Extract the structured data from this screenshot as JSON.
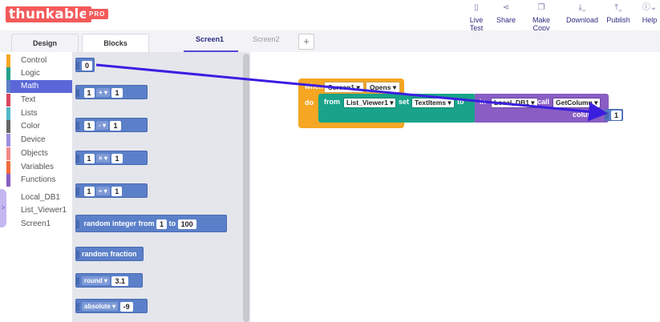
{
  "header": {
    "logo": "thunkable",
    "badge": "PRO",
    "tools": [
      {
        "label": "Live Test",
        "icon": "phone-icon",
        "glyph": "▯"
      },
      {
        "label": "Share",
        "icon": "share-icon",
        "glyph": "⋖"
      },
      {
        "label": "Make Copy",
        "icon": "copy-icon",
        "glyph": "❐"
      },
      {
        "label": "Download",
        "icon": "download-icon",
        "glyph": "⤓⌄"
      },
      {
        "label": "Publish",
        "icon": "upload-icon",
        "glyph": "⤒⌄"
      },
      {
        "label": "Help",
        "icon": "help-icon",
        "glyph": "ⓘ⌄"
      }
    ]
  },
  "tabs": {
    "design": "Design",
    "blocks": "Blocks",
    "screens": [
      "Screen1",
      "Screen2"
    ],
    "add": "+"
  },
  "sidebar": {
    "categories": [
      {
        "label": "Control",
        "color": "#f5a623"
      },
      {
        "label": "Logic",
        "color": "#22a08a"
      },
      {
        "label": "Math",
        "color": "#5b80c9"
      },
      {
        "label": "Text",
        "color": "#d9475c"
      },
      {
        "label": "Lists",
        "color": "#4fb8c9"
      },
      {
        "label": "Color",
        "color": "#666666"
      },
      {
        "label": "Device",
        "color": "#9c8fe0"
      },
      {
        "label": "Objects",
        "color": "#f08a8a"
      },
      {
        "label": "Variables",
        "color": "#f06a3a"
      },
      {
        "label": "Functions",
        "color": "#8a5dc4"
      }
    ],
    "components": [
      "Local_DB1",
      "List_Viewer1",
      "Screen1"
    ],
    "toggle": ">"
  },
  "flyout": {
    "number": "0",
    "ops": [
      {
        "a": "1",
        "op": "+",
        "b": "1"
      },
      {
        "a": "1",
        "op": "-",
        "b": "1"
      },
      {
        "a": "1",
        "op": "×",
        "b": "1"
      },
      {
        "a": "1",
        "op": "÷",
        "b": "1"
      }
    ],
    "random_int": {
      "label": "random integer from",
      "from": "1",
      "to_label": "to",
      "to": "100"
    },
    "random_fraction": "random fraction",
    "round": {
      "label": "round",
      "value": "3.1"
    },
    "absolute": {
      "label": "absolute",
      "value": "-9"
    }
  },
  "workspace": {
    "event": {
      "when": "when",
      "screen": "Screen1",
      "event": "Opens",
      "do": "do"
    },
    "set": {
      "from": "from",
      "component": "List_Viewer1",
      "set": "set",
      "prop": "TextItems",
      "to": "to"
    },
    "call": {
      "in": "in",
      "db": "Local_DB1",
      "call": "call",
      "method": "GetColumn",
      "column_label": "column",
      "column_value": "1"
    }
  },
  "colors": {
    "accent": "#5548d9",
    "brand": "#f35a5a",
    "control": "#f5a623",
    "logic": "#1aa38a",
    "math": "#5b80c9",
    "functions": "#8a5dc4",
    "arrow": "#3a1ee0"
  }
}
